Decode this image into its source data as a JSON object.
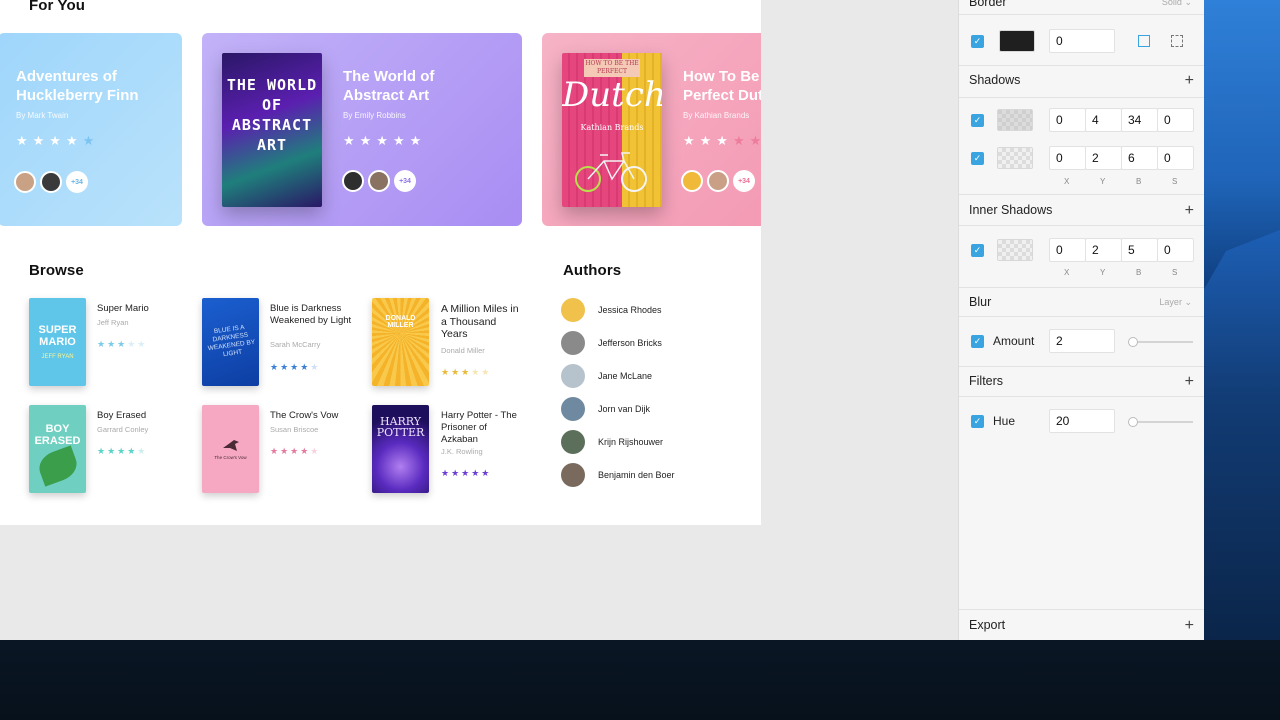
{
  "canvas": {
    "for_you_title": "For You",
    "browse_title": "Browse",
    "authors_title": "Authors",
    "featured": [
      {
        "title": "Adventures of Huckleberry Finn",
        "author": "By Mark Twain",
        "rating": 4,
        "more": "+34",
        "color": "#a7d9f8"
      },
      {
        "title": "The World of Abstract Art",
        "author": "By Emily Robbins",
        "rating": 5,
        "more": "+34",
        "color": "#b69ef7",
        "cover_text": "THE WORLD OF ABSTRACT ART"
      },
      {
        "title": "How To Be Perfect Dut",
        "author": "By Kathian Brands",
        "rating": 3,
        "more": "+34",
        "color": "#f7a9bf",
        "cover_top": "HOW TO BE THE PERFECT",
        "cover_big": "Dutch",
        "cover_author": "Kathian Brands"
      }
    ],
    "browse": [
      {
        "title": "Super Mario",
        "author": "Jeff Ryan",
        "rating": 3,
        "star_color": "#7ccbe9",
        "cover_text": "SUPER MARIO",
        "cover_sub": "JEFF RYAN"
      },
      {
        "title": "Blue is Darkness Weakened by Light",
        "author": "Sarah McCarry",
        "rating": 4,
        "star_color": "#3a7fd6",
        "cover_text": "BLUE IS A DARKNESS WEAKENED BY LIGHT"
      },
      {
        "title": "A Million Miles in a Thousand Years",
        "author": "Donald Miller",
        "rating": 3,
        "star_color": "#e9b93a",
        "cover_text": "DONALD MILLER"
      },
      {
        "title": "Boy Erased",
        "author": "Garrard Conley",
        "rating": 4,
        "star_color": "#5ad3c9",
        "cover_text": "BOY ERASED"
      },
      {
        "title": "The Crow's Vow",
        "author": "Susan Briscoe",
        "rating": 4,
        "star_color": "#e47a9e",
        "cover_text": "The Crow's Vow"
      },
      {
        "title": "Harry Potter - The Prisoner of Azkaban",
        "author": "J.K. Rowling",
        "rating": 5,
        "star_color": "#6c3fd1",
        "cover_text": "HARRY POTTER"
      }
    ],
    "authors": [
      {
        "name": "Jessica Rhodes",
        "color": "#f0c24b"
      },
      {
        "name": "Jefferson Bricks",
        "color": "#8a8a8a"
      },
      {
        "name": "Jane McLane",
        "color": "#b7c3cc"
      },
      {
        "name": "Jorn van Dijk",
        "color": "#6f8aa0"
      },
      {
        "name": "Krijn Rijshouwer",
        "color": "#5c6f5a"
      },
      {
        "name": "Benjamin den Boer",
        "color": "#7a6a5e"
      }
    ]
  },
  "inspector": {
    "border": {
      "label": "Border",
      "type": "Solid",
      "enabled": true,
      "color": "#1f1f1f",
      "width": "0"
    },
    "shadows": {
      "label": "Shadows",
      "items": [
        {
          "enabled": true,
          "x": "0",
          "y": "4",
          "b": "34",
          "s": "0"
        },
        {
          "enabled": true,
          "x": "0",
          "y": "2",
          "b": "6",
          "s": "0"
        }
      ],
      "col_x": "X",
      "col_y": "Y",
      "col_b": "B",
      "col_s": "S"
    },
    "inner_shadows": {
      "label": "Inner Shadows",
      "items": [
        {
          "enabled": true,
          "x": "0",
          "y": "2",
          "b": "5",
          "s": "0"
        }
      ],
      "col_x": "X",
      "col_y": "Y",
      "col_b": "B",
      "col_s": "S"
    },
    "blur": {
      "label": "Blur",
      "type": "Layer",
      "amount_label": "Amount",
      "amount": "2"
    },
    "filters": {
      "label": "Filters",
      "hue_label": "Hue",
      "hue": "20"
    },
    "export": {
      "label": "Export"
    }
  },
  "icons": {
    "plus": "+",
    "check": "✓",
    "star": "★",
    "chevron": "⌄"
  }
}
